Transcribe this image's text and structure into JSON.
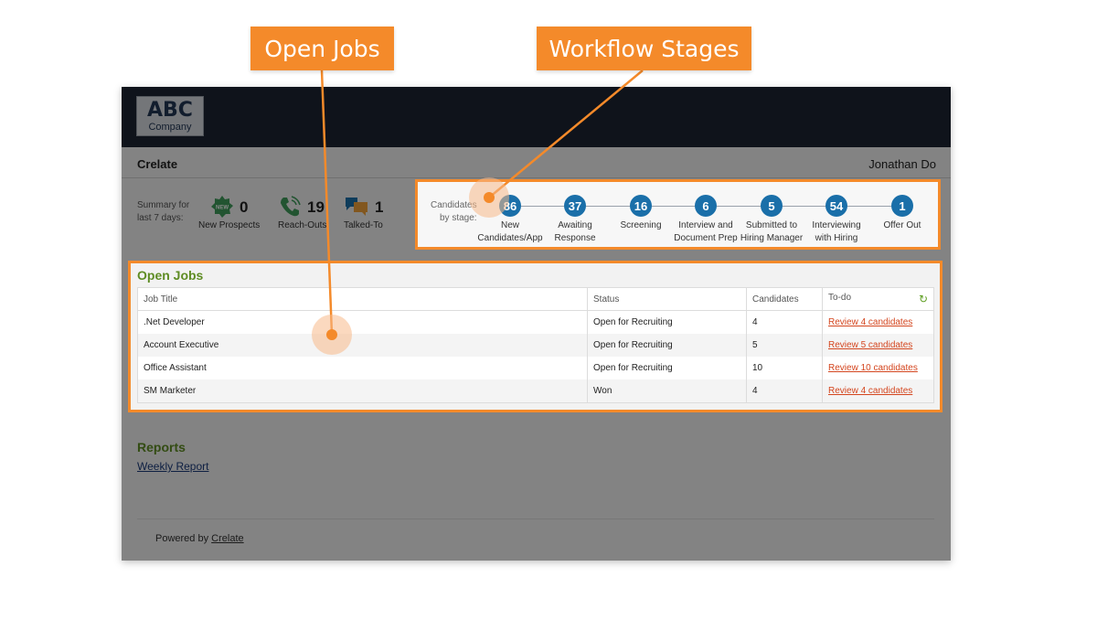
{
  "callouts": {
    "open_jobs": "Open Jobs",
    "workflow_stages": "Workflow Stages"
  },
  "accent_color": "#f48a2a",
  "logo": {
    "line1": "ABC",
    "line2": "Company"
  },
  "header": {
    "app_name": "Crelate",
    "user_name": "Jonathan Do"
  },
  "summary": {
    "label_line1": "Summary for",
    "label_line2": "last 7 days:",
    "stats": [
      {
        "icon": "new-badge-icon",
        "value": "0",
        "label": "New Prospects",
        "badge_text": "NEW"
      },
      {
        "icon": "phone-icon",
        "value": "19",
        "label": "Reach-Outs"
      },
      {
        "icon": "chat-bubbles-icon",
        "value": "1",
        "label": "Talked-To"
      }
    ]
  },
  "workflow": {
    "label_line1": "Candidates",
    "label_line2": "by stage:",
    "stages": [
      {
        "count": "86",
        "line1": "New",
        "line2": "Candidates/App"
      },
      {
        "count": "37",
        "line1": "Awaiting",
        "line2": "Response"
      },
      {
        "count": "16",
        "line1": "Screening",
        "line2": ""
      },
      {
        "count": "6",
        "line1": "Interview and",
        "line2": "Document Prep"
      },
      {
        "count": "5",
        "line1": "Submitted to",
        "line2": "Hiring Manager"
      },
      {
        "count": "54",
        "line1": "Interviewing",
        "line2": "with Hiring"
      },
      {
        "count": "1",
        "line1": "Offer Out",
        "line2": ""
      }
    ]
  },
  "open_jobs": {
    "title": "Open Jobs",
    "columns": [
      "Job Title",
      "Status",
      "Candidates",
      "To-do"
    ],
    "rows": [
      {
        "title": ".Net Developer",
        "status": "Open for Recruiting",
        "candidates": "4",
        "todo": "Review 4 candidates"
      },
      {
        "title": "Account Executive",
        "status": "Open for Recruiting",
        "candidates": "5",
        "todo": "Review 5 candidates"
      },
      {
        "title": "Office Assistant",
        "status": "Open for Recruiting",
        "candidates": "10",
        "todo": "Review 10 candidates"
      },
      {
        "title": "SM Marketer",
        "status": "Won",
        "candidates": "4",
        "todo": "Review 4 candidates"
      }
    ]
  },
  "reports": {
    "title": "Reports",
    "weekly_link": "Weekly Report"
  },
  "footer": {
    "prefix": "Powered by",
    "link": "Crelate"
  }
}
